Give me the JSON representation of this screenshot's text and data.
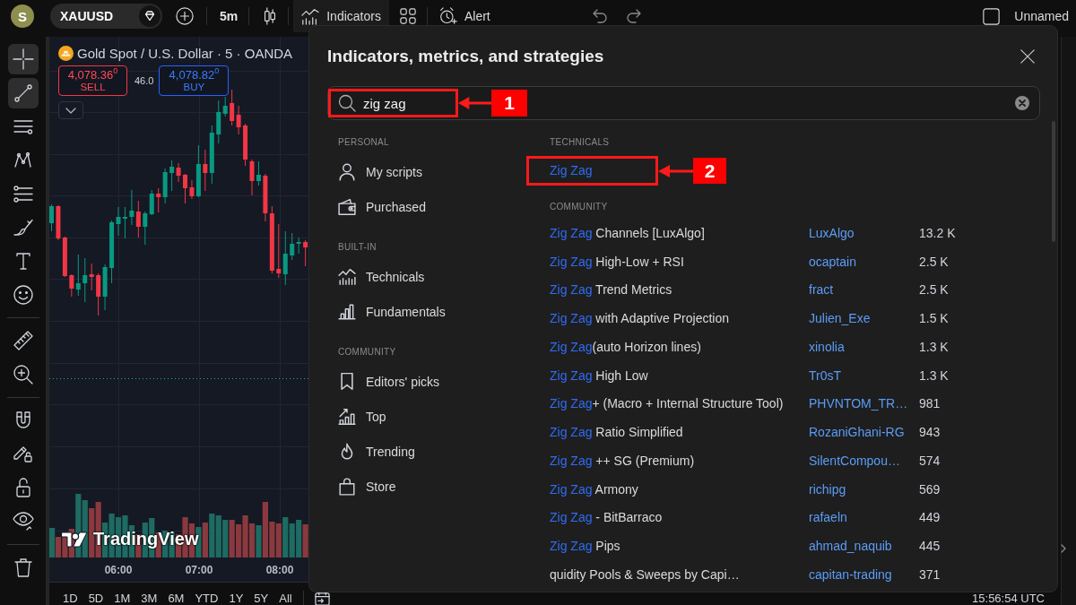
{
  "top_bar": {
    "avatar": "S",
    "symbol": "XAUUSD",
    "interval": "5m",
    "indicators_button": "Indicators",
    "alerts_button": "Alert",
    "layout_name": "Unnamed"
  },
  "drawing_toolbar": {
    "groups": [
      {
        "tools": [
          {
            "kind": "crosshair",
            "selected": true
          },
          {
            "kind": "trendline",
            "selected": true
          },
          {
            "kind": "lines",
            "selected": false
          },
          {
            "kind": "pattern",
            "selected": false
          },
          {
            "kind": "position",
            "selected": false
          },
          {
            "kind": "brush",
            "selected": false
          },
          {
            "kind": "text",
            "selected": false
          },
          {
            "kind": "emoji",
            "selected": false
          }
        ]
      },
      {
        "tools": [
          {
            "kind": "ruler",
            "selected": false
          },
          {
            "kind": "zoom",
            "selected": false
          }
        ]
      },
      {
        "tools": [
          {
            "kind": "magnet",
            "selected": false
          },
          {
            "kind": "drawlock",
            "selected": false
          },
          {
            "kind": "lock",
            "selected": false
          },
          {
            "kind": "eye",
            "selected": false
          }
        ]
      },
      {
        "tools": [
          {
            "kind": "trash",
            "selected": false
          }
        ]
      }
    ]
  },
  "chart": {
    "title": "Gold Spot / U.S. Dollar · 5 · OANDA",
    "sell": {
      "price": "4,078.36$^{0}$",
      "label": "SELL"
    },
    "spread": "46.0",
    "buy": {
      "price": "4,078.82$^{0}$",
      "label": "BUY"
    },
    "time_axis": [
      "06:00",
      "07:00",
      "08:00"
    ],
    "logo": "TradingView"
  },
  "bottom_bar": {
    "ranges": [
      "1D",
      "5D",
      "1M",
      "3M",
      "6M",
      "YTD",
      "1Y",
      "5Y",
      "All"
    ],
    "clock": "15:56:54 UTC"
  },
  "dialog": {
    "title": "Indicators, metrics, and strategies",
    "search": {
      "value": "zig zag",
      "callout": "1"
    },
    "categories": [
      {
        "heading": "PERSONAL",
        "items": [
          {
            "kind": "user",
            "label": "My scripts"
          },
          {
            "kind": "wallet",
            "label": "Purchased"
          }
        ]
      },
      {
        "heading": "BUILT-IN",
        "items": [
          {
            "kind": "technicals",
            "label": "Technicals"
          },
          {
            "kind": "fundamentals",
            "label": "Fundamentals"
          }
        ]
      },
      {
        "heading": "COMMUNITY",
        "items": [
          {
            "kind": "bookmark",
            "label": "Editors' picks"
          },
          {
            "kind": "top",
            "label": "Top"
          },
          {
            "kind": "flame",
            "label": "Trending"
          },
          {
            "kind": "bag",
            "label": "Store"
          }
        ]
      }
    ],
    "technicals": {
      "heading": "TECHNICALS",
      "items": [
        {
          "match": "Zig Zag",
          "callout": "2"
        }
      ]
    },
    "community": {
      "heading": "COMMUNITY",
      "rows": [
        {
          "match": "Zig Zag",
          "rest": " Channels [LuxAlgo]",
          "author": "LuxAlgo",
          "count": "13.2 K"
        },
        {
          "match": "Zig Zag",
          "rest": " High-Low + RSI",
          "author": "ocaptain",
          "count": "2.5 K"
        },
        {
          "match": "Zig Zag",
          "rest": " Trend Metrics",
          "author": "fract",
          "count": "2.5 K"
        },
        {
          "match": "Zig Zag",
          "rest": " with Adaptive Projection",
          "author": "Julien_Exe",
          "count": "1.5 K"
        },
        {
          "match": "Zig Zag",
          "rest": "(auto Horizon lines)",
          "author": "xinolia",
          "count": "1.3 K"
        },
        {
          "match": "Zig Zag",
          "rest": " High Low",
          "author": "Tr0sT",
          "count": "1.3 K"
        },
        {
          "match": "Zig Zag",
          "rest": "+ (Macro + Internal Structure Tool)",
          "author": "PHVNTOM_TR…",
          "count": "981"
        },
        {
          "match": "Zig Zag",
          "rest": " Ratio Simplified",
          "author": "RozaniGhani-RG",
          "count": "943"
        },
        {
          "match": "Zig Zag",
          "rest": " ++ SG (Premium)",
          "author": "SilentCompou…",
          "count": "574"
        },
        {
          "match": "Zig Zag",
          "rest": " Armony",
          "author": "richipg",
          "count": "569"
        },
        {
          "match": "Zig Zag",
          "rest": " - BitBarraco",
          "author": "rafaeln",
          "count": "449"
        },
        {
          "match": "Zig Zag",
          "rest": " Pips",
          "author": "ahmad_naquib",
          "count": "445"
        },
        {
          "rest": "quidity Pools & Sweeps by Capi…",
          "author": "capitan-trading",
          "count": "371"
        }
      ]
    }
  }
}
